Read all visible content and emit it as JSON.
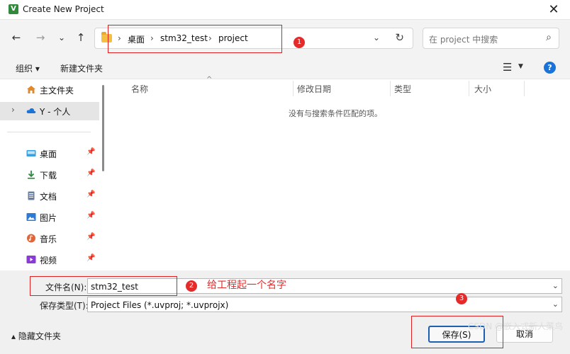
{
  "window": {
    "title": "Create New Project",
    "app_icon": "V",
    "close": "✕"
  },
  "nav": {
    "back": "←",
    "forward": "→",
    "recent": "⌄",
    "up": "↑",
    "breadcrumb": [
      "桌面",
      "stm32_test",
      "project"
    ],
    "sep": "›",
    "addr_chevron": "⌄",
    "refresh": "↻",
    "search_placeholder": "在 project 中搜索",
    "search_icon": "⌕"
  },
  "toolbar": {
    "organize": "组织 ▾",
    "new_folder": "新建文件夹",
    "view_icon": "☰",
    "view_dd": "▼",
    "help": "?"
  },
  "sidebar": {
    "items": [
      {
        "label": "主文件夹",
        "icon": "home-icon",
        "color": "#e08a2a"
      },
      {
        "label": "Y - 个人",
        "icon": "cloud-icon",
        "color": "#1a73d9",
        "expander": "›"
      },
      {
        "label": "桌面",
        "icon": "desktop-icon",
        "color": "#3aa0e0",
        "pin": "📌"
      },
      {
        "label": "下载",
        "icon": "download-icon",
        "color": "#2d8a3a",
        "pin": "📌"
      },
      {
        "label": "文档",
        "icon": "document-icon",
        "color": "#6b7fa0",
        "pin": "📌"
      },
      {
        "label": "图片",
        "icon": "picture-icon",
        "color": "#2a7ad6",
        "pin": "📌"
      },
      {
        "label": "音乐",
        "icon": "music-icon",
        "color": "#e0663a",
        "pin": "📌"
      },
      {
        "label": "视频",
        "icon": "video-icon",
        "color": "#8a3ad6",
        "pin": "📌"
      }
    ]
  },
  "columns": [
    "名称",
    "修改日期",
    "类型",
    "大小"
  ],
  "sort_caret": "^",
  "empty_message": "没有与搜索条件匹配的项。",
  "filename": {
    "label": "文件名(N):",
    "value": "stm32_test",
    "dd": "⌄"
  },
  "filetype": {
    "label": "保存类型(T):",
    "value": "Project Files (*.uvproj; *.uvprojx)",
    "dd": "⌄"
  },
  "hide_folders": "▴  隐藏文件夹",
  "buttons": {
    "save": "保存(S)",
    "cancel": "取消"
  },
  "annotations": {
    "b1": "1",
    "b2": "2",
    "b3": "3",
    "note": "给工程起一个名字",
    "color": "#e52a2a"
  },
  "watermark": "CSDN @嵌入式新人菜鸟"
}
